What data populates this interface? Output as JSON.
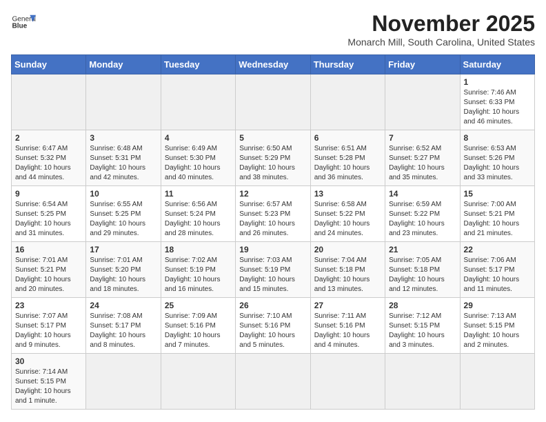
{
  "logo": {
    "line1": "General",
    "line2": "Blue"
  },
  "title": "November 2025",
  "subtitle": "Monarch Mill, South Carolina, United States",
  "weekdays": [
    "Sunday",
    "Monday",
    "Tuesday",
    "Wednesday",
    "Thursday",
    "Friday",
    "Saturday"
  ],
  "weeks": [
    [
      {
        "day": "",
        "info": ""
      },
      {
        "day": "",
        "info": ""
      },
      {
        "day": "",
        "info": ""
      },
      {
        "day": "",
        "info": ""
      },
      {
        "day": "",
        "info": ""
      },
      {
        "day": "",
        "info": ""
      },
      {
        "day": "1",
        "info": "Sunrise: 7:46 AM\nSunset: 6:33 PM\nDaylight: 10 hours and 46 minutes."
      }
    ],
    [
      {
        "day": "2",
        "info": "Sunrise: 6:47 AM\nSunset: 5:32 PM\nDaylight: 10 hours and 44 minutes."
      },
      {
        "day": "3",
        "info": "Sunrise: 6:48 AM\nSunset: 5:31 PM\nDaylight: 10 hours and 42 minutes."
      },
      {
        "day": "4",
        "info": "Sunrise: 6:49 AM\nSunset: 5:30 PM\nDaylight: 10 hours and 40 minutes."
      },
      {
        "day": "5",
        "info": "Sunrise: 6:50 AM\nSunset: 5:29 PM\nDaylight: 10 hours and 38 minutes."
      },
      {
        "day": "6",
        "info": "Sunrise: 6:51 AM\nSunset: 5:28 PM\nDaylight: 10 hours and 36 minutes."
      },
      {
        "day": "7",
        "info": "Sunrise: 6:52 AM\nSunset: 5:27 PM\nDaylight: 10 hours and 35 minutes."
      },
      {
        "day": "8",
        "info": "Sunrise: 6:53 AM\nSunset: 5:26 PM\nDaylight: 10 hours and 33 minutes."
      }
    ],
    [
      {
        "day": "9",
        "info": "Sunrise: 6:54 AM\nSunset: 5:25 PM\nDaylight: 10 hours and 31 minutes."
      },
      {
        "day": "10",
        "info": "Sunrise: 6:55 AM\nSunset: 5:25 PM\nDaylight: 10 hours and 29 minutes."
      },
      {
        "day": "11",
        "info": "Sunrise: 6:56 AM\nSunset: 5:24 PM\nDaylight: 10 hours and 28 minutes."
      },
      {
        "day": "12",
        "info": "Sunrise: 6:57 AM\nSunset: 5:23 PM\nDaylight: 10 hours and 26 minutes."
      },
      {
        "day": "13",
        "info": "Sunrise: 6:58 AM\nSunset: 5:22 PM\nDaylight: 10 hours and 24 minutes."
      },
      {
        "day": "14",
        "info": "Sunrise: 6:59 AM\nSunset: 5:22 PM\nDaylight: 10 hours and 23 minutes."
      },
      {
        "day": "15",
        "info": "Sunrise: 7:00 AM\nSunset: 5:21 PM\nDaylight: 10 hours and 21 minutes."
      }
    ],
    [
      {
        "day": "16",
        "info": "Sunrise: 7:01 AM\nSunset: 5:21 PM\nDaylight: 10 hours and 20 minutes."
      },
      {
        "day": "17",
        "info": "Sunrise: 7:01 AM\nSunset: 5:20 PM\nDaylight: 10 hours and 18 minutes."
      },
      {
        "day": "18",
        "info": "Sunrise: 7:02 AM\nSunset: 5:19 PM\nDaylight: 10 hours and 16 minutes."
      },
      {
        "day": "19",
        "info": "Sunrise: 7:03 AM\nSunset: 5:19 PM\nDaylight: 10 hours and 15 minutes."
      },
      {
        "day": "20",
        "info": "Sunrise: 7:04 AM\nSunset: 5:18 PM\nDaylight: 10 hours and 13 minutes."
      },
      {
        "day": "21",
        "info": "Sunrise: 7:05 AM\nSunset: 5:18 PM\nDaylight: 10 hours and 12 minutes."
      },
      {
        "day": "22",
        "info": "Sunrise: 7:06 AM\nSunset: 5:17 PM\nDaylight: 10 hours and 11 minutes."
      }
    ],
    [
      {
        "day": "23",
        "info": "Sunrise: 7:07 AM\nSunset: 5:17 PM\nDaylight: 10 hours and 9 minutes."
      },
      {
        "day": "24",
        "info": "Sunrise: 7:08 AM\nSunset: 5:17 PM\nDaylight: 10 hours and 8 minutes."
      },
      {
        "day": "25",
        "info": "Sunrise: 7:09 AM\nSunset: 5:16 PM\nDaylight: 10 hours and 7 minutes."
      },
      {
        "day": "26",
        "info": "Sunrise: 7:10 AM\nSunset: 5:16 PM\nDaylight: 10 hours and 5 minutes."
      },
      {
        "day": "27",
        "info": "Sunrise: 7:11 AM\nSunset: 5:16 PM\nDaylight: 10 hours and 4 minutes."
      },
      {
        "day": "28",
        "info": "Sunrise: 7:12 AM\nSunset: 5:15 PM\nDaylight: 10 hours and 3 minutes."
      },
      {
        "day": "29",
        "info": "Sunrise: 7:13 AM\nSunset: 5:15 PM\nDaylight: 10 hours and 2 minutes."
      }
    ],
    [
      {
        "day": "30",
        "info": "Sunrise: 7:14 AM\nSunset: 5:15 PM\nDaylight: 10 hours and 1 minute."
      },
      {
        "day": "",
        "info": ""
      },
      {
        "day": "",
        "info": ""
      },
      {
        "day": "",
        "info": ""
      },
      {
        "day": "",
        "info": ""
      },
      {
        "day": "",
        "info": ""
      },
      {
        "day": "",
        "info": ""
      }
    ]
  ]
}
